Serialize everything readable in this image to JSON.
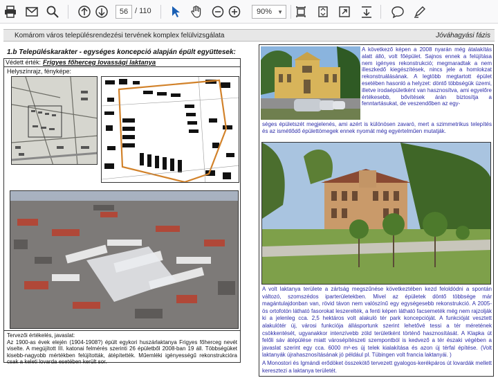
{
  "toolbar": {
    "page_current": "56",
    "page_separator": "/",
    "page_total": "110",
    "zoom": "90%",
    "icons": [
      "print-icon",
      "email-icon",
      "search-icon",
      "arrow-up-icon",
      "arrow-down-icon",
      "select-cursor-icon",
      "hand-icon",
      "zoom-out-icon",
      "zoom-in-icon",
      "fit-width-icon",
      "fit-page-icon",
      "fullscreen-icon",
      "download-icon",
      "comment-icon",
      "draw-icon"
    ]
  },
  "header": {
    "title": "Komárom város településrendezési tervének komplex felülvizsgálata",
    "phase": "Jóváhagyási fázis"
  },
  "section_title": "1.b Településkarakter - egységes koncepció alapján épült együttesek:",
  "left": {
    "protected_label": "Védett érték:",
    "protected_name": "Frigyes főherceg lovassági laktanya",
    "site_label": "Helyszínrajz, fényképe:",
    "eval_title": "Tervezői értékelés, javaslat:",
    "eval_text": "Az 1900-as évek elején (1904-1908?) épült egykori huszárlaktanya Frigyes főherceg nevét viselte. A megújított III. katonai felmérés szerinti 26 épületből 2008-ban 19 áll. Többségüket kisebb-nagyobb mértékben felújították, átépítették. Műemléki igényességű rekonstrukcióra csak a keleti lovarda esetében került sor."
  },
  "right": {
    "text1": "A következő képen a 2008 nyarán még átalakítás alatt álló, volt főépület. Sajnos ennek a felújítása nem igényes rekonstrukció; megmaradtak a nem illeszkedő kiegészítések, nincs jele a homlokzat rekonstruálásának. A legtöbb megtartott épület esetében hasonló a helyzet: döntő többségük üzemi, illetve irodaépületként van hasznosítva, ami egyelőre értékesebb, bővítések árán biztosítja a fenntartásukat, de veszendőben az egy-",
    "text1b": "séges épületszét megjelenés, ami azért is különösen zavaró, mert a szimmetrikus telepítés és az ismétlődő épülettömegek ennek nyomát még egyértelműen mutatják.",
    "text2": "A volt laktanya területe a zártság megszűnése következtében kezd feloldódni a spontán változó, szomszédos iparterületekben. Mivel az épületek döntő többsége már magántulajdonban van, rövid távon nem valószínű egy egységesebb rekonstrukció. A 2005-ös ortofotón látható fasorokat leszerelték, a fenti képen látható facsemeték még nem rajzolják ki a jelenleg cca. 2,5 hektáros volt alakuló tér park koncepcióját. A funkcióját vesztett alakulótér új, városi funkciója állásportunk szerint lehetővé tessi a tér méretének csökkentését, ugyanakkor intenzívebb zöld területként történő hasznosítását. A Klapka út felőli sáv átépülése miatt városépítészeti szempontból is kedvező a tér északi végében a javaslat szerint egy cca. 6000 m²-es új telek kialakítása és azon új térfal építése. (Volt laktanyák újrahasznosításának jó például pl. Tübingen volt francia laktanyái. )",
    "text3": "A Monostori és Igmándi erődöket összekötő tervezett gyalogos-kerékpáros út lovardák mellett keresztezi a laktanya területét."
  }
}
